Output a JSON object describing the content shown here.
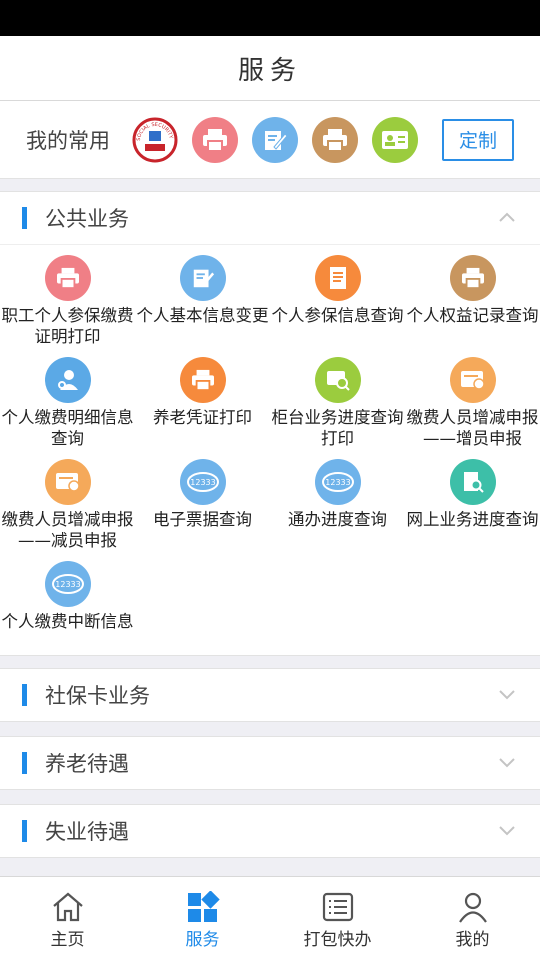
{
  "header": {
    "title": "服务"
  },
  "favorites": {
    "label": "我的常用",
    "customize_label": "定制",
    "badge_text": "SOCIAL SECURITY CARD",
    "icons": [
      {
        "name": "social-security-logo-icon",
        "color": "#c8242b"
      },
      {
        "name": "printer-icon",
        "color": "#f07f86"
      },
      {
        "name": "edit-icon",
        "color": "#6fb3ea"
      },
      {
        "name": "printer-icon",
        "color": "#c8965f"
      },
      {
        "name": "id-card-icon",
        "color": "#9bcc3e"
      }
    ]
  },
  "public_services": {
    "title": "公共业务",
    "items": [
      {
        "label": "职工个人参保缴费证明打印",
        "icon": "printer-icon",
        "color": "#f07f86"
      },
      {
        "label": "个人基本信息变更",
        "icon": "edit-icon",
        "color": "#6fb3ea"
      },
      {
        "label": "个人参保信息查询",
        "icon": "document-icon",
        "color": "#f68a3c"
      },
      {
        "label": "个人权益记录查询",
        "icon": "printer-icon",
        "color": "#c8965f"
      },
      {
        "label": "个人缴费明细信息查询",
        "icon": "user-search-icon",
        "color": "#5ba9e6"
      },
      {
        "label": "养老凭证打印",
        "icon": "printer-icon",
        "color": "#f68a3c"
      },
      {
        "label": "柜台业务进度查询打印",
        "icon": "chat-search-icon",
        "color": "#9bcc3e"
      },
      {
        "label": "缴费人员增减申报——增员申报",
        "icon": "card-plus-icon",
        "color": "#f5a95a"
      },
      {
        "label": "缴费人员增减申报——减员申报",
        "icon": "card-minus-icon",
        "color": "#f5a95a"
      },
      {
        "label": "电子票据查询",
        "icon": "hotline-12333-icon",
        "color": "#6fb3ea"
      },
      {
        "label": "通办进度查询",
        "icon": "hotline-12333-icon",
        "color": "#6fb3ea"
      },
      {
        "label": "网上业务进度查询",
        "icon": "doc-search-icon",
        "color": "#3dbfa8"
      },
      {
        "label": "个人缴费中断信息",
        "icon": "hotline-12333-icon",
        "color": "#6fb3ea"
      }
    ]
  },
  "hotline_text": "12333",
  "sections": [
    {
      "title": "社保卡业务"
    },
    {
      "title": "养老待遇"
    },
    {
      "title": "失业待遇"
    }
  ],
  "tabs": [
    {
      "label": "主页",
      "icon": "home-icon"
    },
    {
      "label": "服务",
      "icon": "grid-icon",
      "active": true
    },
    {
      "label": "打包快办",
      "icon": "list-icon"
    },
    {
      "label": "我的",
      "icon": "user-icon"
    }
  ],
  "colors": {
    "accent": "#1e8ae8"
  }
}
